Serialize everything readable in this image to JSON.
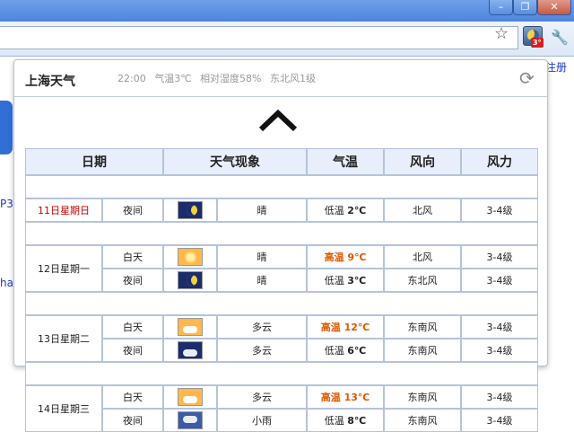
{
  "browser": {
    "extension_badge": "3°",
    "behind_texts": [
      "注册",
      "P3",
      "ha"
    ]
  },
  "popup": {
    "city": "上海天气",
    "time": "22:00",
    "temperature": "气温3℃",
    "humidity": "相对湿度58%",
    "wind": "东北风1级"
  },
  "table": {
    "headers": [
      "日期",
      "天气现象",
      "气温",
      "风向",
      "风力"
    ],
    "rows": [
      {
        "date": "11日星期日",
        "period": "夜间",
        "icon": "moon-icon",
        "weather": "晴",
        "temp_label": "低温",
        "temp_value": "2℃",
        "wind_dir": "北风",
        "wind_force": "3-4级"
      },
      {
        "date": "12日星期一",
        "period": "白天",
        "icon": "sun-icon",
        "weather": "晴",
        "temp_label": "高温",
        "temp_value": "9℃",
        "wind_dir": "北风",
        "wind_force": "3-4级"
      },
      {
        "date": "",
        "period": "夜间",
        "icon": "moon-icon",
        "weather": "晴",
        "temp_label": "低温",
        "temp_value": "3℃",
        "wind_dir": "东北风",
        "wind_force": "3-4级"
      },
      {
        "date": "13日星期二",
        "period": "白天",
        "icon": "cloudy-day-icon",
        "weather": "多云",
        "temp_label": "高温",
        "temp_value": "12℃",
        "wind_dir": "东南风",
        "wind_force": "3-4级"
      },
      {
        "date": "",
        "period": "夜间",
        "icon": "cloudy-night-icon",
        "weather": "多云",
        "temp_label": "低温",
        "temp_value": "6℃",
        "wind_dir": "东南风",
        "wind_force": "3-4级"
      },
      {
        "date": "14日星期三",
        "period": "白天",
        "icon": "cloudy-day-icon",
        "weather": "多云",
        "temp_label": "高温",
        "temp_value": "13℃",
        "wind_dir": "东南风",
        "wind_force": "3-4级"
      },
      {
        "date": "",
        "period": "夜间",
        "icon": "light-rain-icon",
        "weather": "小雨",
        "temp_label": "低温",
        "temp_value": "8℃",
        "wind_dir": "东南风",
        "wind_force": "3-4级"
      }
    ]
  }
}
